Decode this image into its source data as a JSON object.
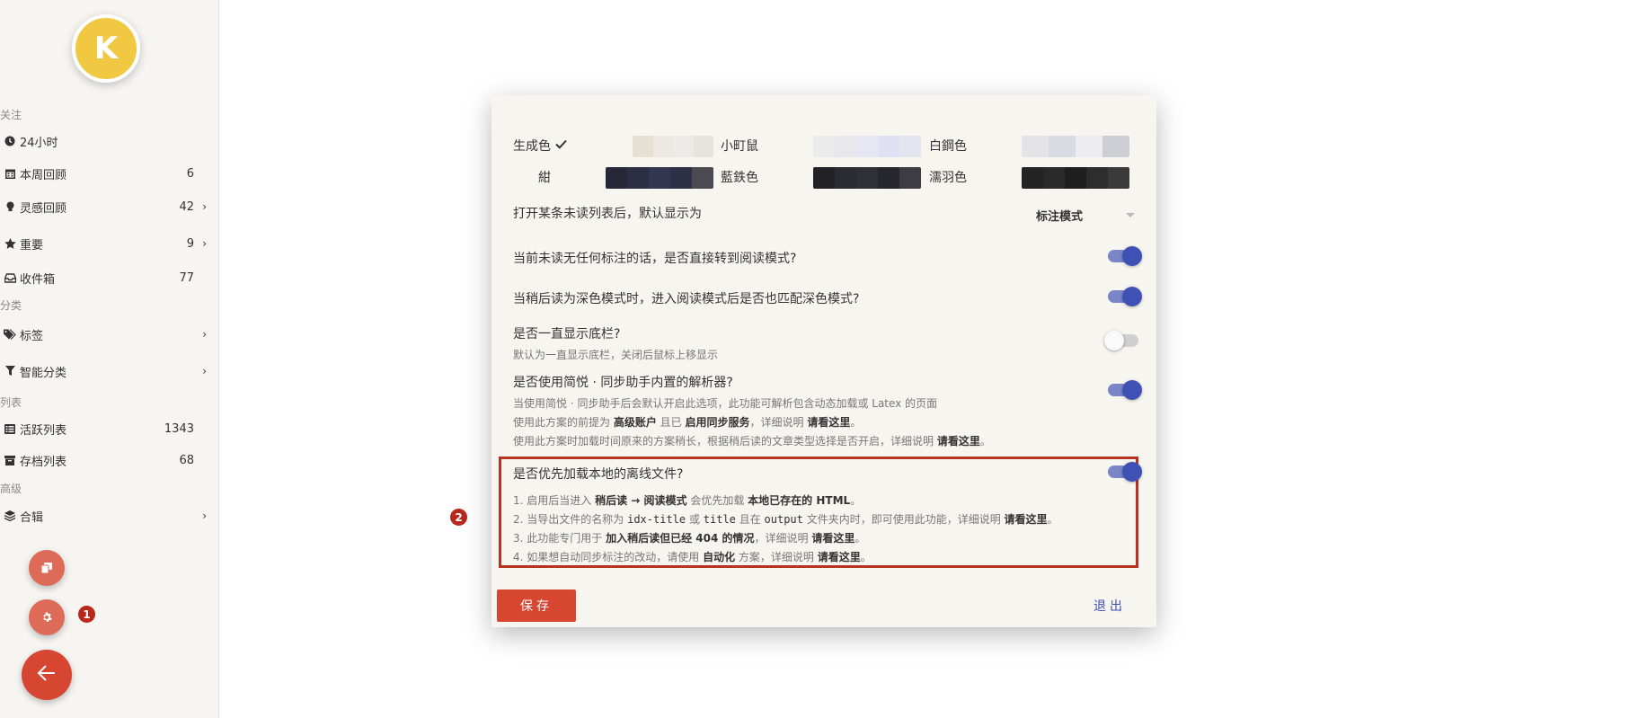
{
  "sidebar": {
    "avatar_letter": "K",
    "sections": {
      "follow": "关注",
      "category": "分类",
      "lists": "列表",
      "advanced": "高级"
    },
    "items": [
      {
        "label": "24小时",
        "count": "",
        "icon": "clock-icon"
      },
      {
        "label": "本周回顾",
        "count": "6",
        "icon": "calendar-icon"
      },
      {
        "label": "灵感回顾",
        "count": "42",
        "icon": "bulb-icon"
      },
      {
        "label": "重要",
        "count": "9",
        "icon": "star-icon"
      },
      {
        "label": "收件箱",
        "count": "77",
        "icon": "inbox-icon"
      },
      {
        "label": "标签",
        "count": "",
        "icon": "tags-icon"
      },
      {
        "label": "智能分类",
        "count": "",
        "icon": "filter-icon"
      },
      {
        "label": "活跃列表",
        "count": "1343",
        "icon": "list-icon"
      },
      {
        "label": "存档列表",
        "count": "68",
        "icon": "archive-icon"
      },
      {
        "label": "合辑",
        "count": "",
        "icon": "layers-icon"
      }
    ],
    "badge_1": "1",
    "accent": "#d64631"
  },
  "dialog": {
    "colors": {
      "row1": [
        {
          "label": "生成色",
          "checked": true,
          "swatches": [
            "#e6e0d2",
            "#ece9e3",
            "#ecebe7",
            "#e6e4df"
          ]
        },
        {
          "label": "小町鼠",
          "swatches": [
            "#ebebeb",
            "#e7e7ec",
            "#e6e7f2",
            "#dfe0f3",
            "#e4e4ee"
          ]
        },
        {
          "label": "白鋼色",
          "swatches": [
            "#e4e4e8",
            "#d9dae2",
            "#ededf1",
            "#cdced4"
          ]
        }
      ],
      "row2": [
        {
          "label": "紺",
          "swatches": [
            "#262838",
            "#2c2f44",
            "#343750",
            "#2e3047",
            "#4a4a50"
          ]
        },
        {
          "label": "藍鉄色",
          "swatches": [
            "#222226",
            "#2b2c33",
            "#2f3038",
            "#26272c",
            "#3c3c42"
          ]
        },
        {
          "label": "濡羽色",
          "swatches": [
            "#242424",
            "#2a2a2a",
            "#1e1e1e",
            "#2d2d2d",
            "#3a3a3a"
          ]
        }
      ]
    },
    "default_view_label": "打开某条未读列表后，默认显示为",
    "default_view_value": "标注模式",
    "opt_reader": "当前未读无任何标注的话，是否直接转到阅读模式?",
    "opt_dark": "当稍后读为深色模式时，进入阅读模式后是否也匹配深色模式?",
    "opt_footer": "是否一直显示底栏?",
    "opt_footer_desc": "默认为一直显示底栏，关闭后鼠标上移显示",
    "opt_parser": "是否使用简悦 · 同步助手内置的解析器?",
    "opt_parser_desc1": "当使用简悦 · 同步助手后会默认开启此选项，此功能可解析包含动态加载或 Latex 的页面",
    "opt_parser_desc2_a": "使用此方案的前提为 ",
    "opt_parser_desc2_b": "高级账户",
    "opt_parser_desc2_c": " 且已 ",
    "opt_parser_desc2_d": "启用同步服务",
    "opt_parser_desc2_e": "，详细说明 ",
    "opt_parser_desc2_f": "请看这里",
    "opt_parser_desc2_g": "。",
    "opt_parser_desc3_a": "使用此方案时加载时间原来的方案稍长，根据稍后读的文章类型选择是否开启，详细说明 ",
    "opt_parser_desc3_b": "请看这里",
    "opt_parser_desc3_c": "。",
    "opt_offline": "是否优先加载本地的离线文件?",
    "offline_desc1_a": "1. 启用后当进入 ",
    "offline_desc1_b": "稍后读 → 阅读模式",
    "offline_desc1_c": " 会优先加载 ",
    "offline_desc1_d": "本地已存在的 HTML",
    "offline_desc1_e": "。",
    "offline_desc2_a": "2. 当导出文件的名称为 ",
    "offline_desc2_b": "idx-title",
    "offline_desc2_c": " 或 ",
    "offline_desc2_d": "title",
    "offline_desc2_e": " 且在 ",
    "offline_desc2_f": "output",
    "offline_desc2_g": " 文件夹内时，即可使用此功能，详细说明 ",
    "offline_desc2_h": "请看这里",
    "offline_desc2_i": "。",
    "offline_desc3_a": "3. 此功能专门用于 ",
    "offline_desc3_b": "加入稍后读但已经 404 的情况",
    "offline_desc3_c": "，详细说明 ",
    "offline_desc3_d": "请看这里",
    "offline_desc3_e": "。",
    "offline_desc4_a": "4. 如果想自动同步标注的改动，请使用 ",
    "offline_desc4_b": "自动化",
    "offline_desc4_c": " 方案，详细说明 ",
    "offline_desc4_d": "请看这里",
    "offline_desc4_e": "。",
    "save": "保存",
    "exit": "退出",
    "badge_2": "2",
    "toggle_on_color": "#3f51b5"
  }
}
